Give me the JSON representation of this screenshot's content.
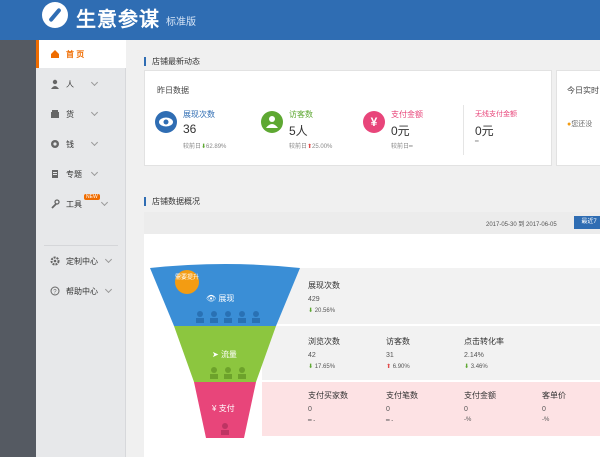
{
  "app": {
    "title": "生意参谋",
    "edition": "标准版"
  },
  "sidebar": {
    "items": [
      {
        "label": "首 页",
        "active": true
      },
      {
        "label": "人"
      },
      {
        "label": "货"
      },
      {
        "label": "钱"
      },
      {
        "label": "专题"
      },
      {
        "label": "工具",
        "badge": "NEW"
      },
      {
        "label": "定制中心"
      },
      {
        "label": "帮助中心"
      }
    ]
  },
  "realtime": {
    "section_title": "店铺最新动态",
    "card_title": "昨日数据",
    "stats": [
      {
        "label": "展现次数",
        "value": "36",
        "cmp_label": "较前日",
        "cmp_dir": "down",
        "cmp_value": "62.89%",
        "color": "#2f6db3"
      },
      {
        "label": "访客数",
        "value": "5人",
        "cmp_label": "较前日",
        "cmp_dir": "up",
        "cmp_value": "25.00%",
        "color": "#5ea832"
      },
      {
        "label": "支付金额",
        "value": "0元",
        "cmp_label": "较前日",
        "cmp_dir": "flat",
        "cmp_value": "━",
        "color": "#e8457a"
      },
      {
        "label": "无线支付金额",
        "value": "0元",
        "cmp_label": "",
        "cmp_dir": "flat",
        "cmp_value": "━",
        "color": "#e8457a"
      }
    ],
    "side_card_title": "今日实时",
    "side_card_text": "您还没"
  },
  "overview": {
    "section_title": "店铺数据概况",
    "date_range": "2017-05-30 到 2017-06-05",
    "recent_button": "最近7",
    "promo_badge": "需要提升",
    "funnel": [
      {
        "label": "展现"
      },
      {
        "label": "流量"
      },
      {
        "label": "支付"
      }
    ],
    "row1": [
      {
        "label": "展现次数",
        "value": "429",
        "cmp_dir": "down",
        "cmp": "20.56%"
      }
    ],
    "row2": [
      {
        "label": "浏览次数",
        "value": "42",
        "cmp_dir": "down",
        "cmp": "17.65%"
      },
      {
        "label": "访客数",
        "value": "31",
        "cmp_dir": "up",
        "cmp": "6.90%"
      },
      {
        "label": "点击转化率",
        "value": "2.14%",
        "cmp_dir": "down",
        "cmp": "3.46%"
      }
    ],
    "row3": [
      {
        "label": "支付买家数",
        "value": "0",
        "cmp": "━ -"
      },
      {
        "label": "支付笔数",
        "value": "0",
        "cmp": "━ -"
      },
      {
        "label": "支付金额",
        "value": "0",
        "cmp": "-%"
      },
      {
        "label": "客单价",
        "value": "0",
        "cmp": "-%"
      }
    ]
  }
}
